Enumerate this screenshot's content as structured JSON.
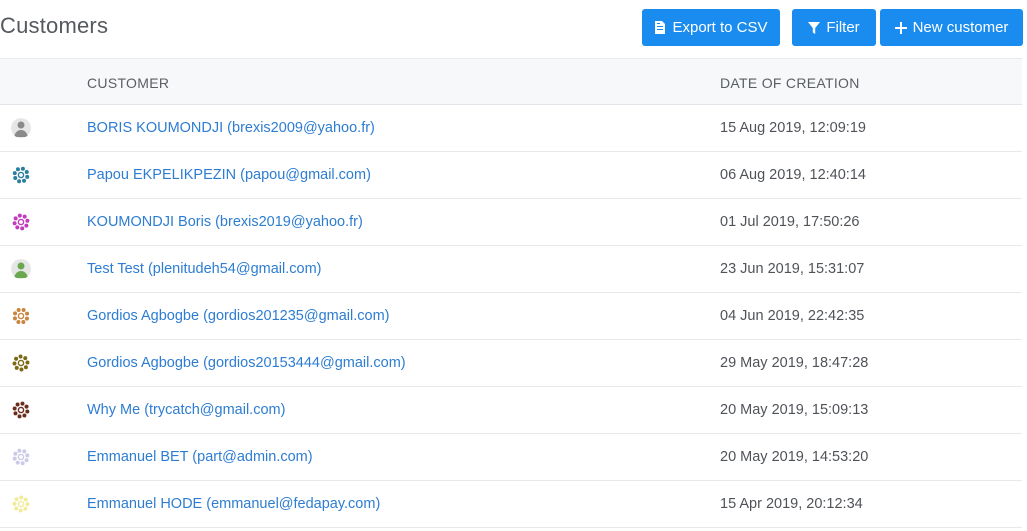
{
  "header": {
    "title": "Customers",
    "export_label": "Export to CSV",
    "filter_label": "Filter",
    "new_label": "New customer"
  },
  "table": {
    "columns": [
      "CUSTOMER",
      "DATE OF CREATION"
    ],
    "rows": [
      {
        "customer": "BORIS KOUMONDJI (brexis2009@yahoo.fr)",
        "date": "15 Aug 2019, 12:09:19",
        "avatar": "photo-avatar",
        "color": "#8a8a8a"
      },
      {
        "customer": "Papou EKPELIKPEZIN (papou@gmail.com)",
        "date": "06 Aug 2019, 12:40:14",
        "avatar": "identicon-avatar",
        "color": "#2a7f9e"
      },
      {
        "customer": "KOUMONDJI Boris (brexis2019@yahoo.fr)",
        "date": "01 Jul 2019, 17:50:26",
        "avatar": "identicon-avatar",
        "color": "#c23bbd"
      },
      {
        "customer": "Test Test (plenitudeh54@gmail.com)",
        "date": "23 Jun 2019, 15:31:07",
        "avatar": "photo-avatar",
        "color": "#6aa84f"
      },
      {
        "customer": "Gordios Agbogbe (gordios201235@gmail.com)",
        "date": "04 Jun 2019, 22:42:35",
        "avatar": "identicon-avatar",
        "color": "#c8863f"
      },
      {
        "customer": "Gordios Agbogbe (gordios20153444@gmail.com)",
        "date": "29 May 2019, 18:47:28",
        "avatar": "identicon-avatar",
        "color": "#7a6a12"
      },
      {
        "customer": "Why Me (trycatch@gmail.com)",
        "date": "20 May 2019, 15:09:13",
        "avatar": "identicon-avatar",
        "color": "#6b2e1c"
      },
      {
        "customer": "Emmanuel BET (part@admin.com)",
        "date": "20 May 2019, 14:53:20",
        "avatar": "identicon-avatar",
        "color": "#c9cbe8"
      },
      {
        "customer": "Emmanuel HODE (emmanuel@fedapay.com)",
        "date": "15 Apr 2019, 20:12:34",
        "avatar": "identicon-avatar",
        "color": "#f2ec9a"
      }
    ]
  },
  "colors": {
    "accent": "#1a8cf0",
    "link": "#2d7dd2",
    "header_bg": "#f7f8fa"
  }
}
